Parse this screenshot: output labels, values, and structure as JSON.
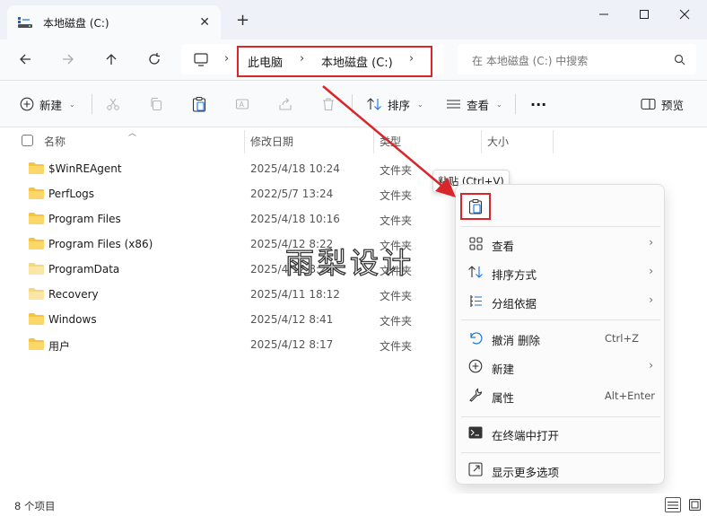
{
  "window": {
    "tab_title": "本地磁盘 (C:)",
    "new_tab_label": "+",
    "close_tab_label": "✕"
  },
  "nav": {
    "breadcrumbs": [
      "此电脑",
      "本地磁盘 (C:)"
    ],
    "search_placeholder": "在 本地磁盘 (C:) 中搜索"
  },
  "toolbar": {
    "new_label": "新建",
    "sort_label": "排序",
    "view_label": "查看",
    "more_label": "...",
    "preview_label": "预览"
  },
  "columns": {
    "name": "名称",
    "date": "修改日期",
    "type": "类型",
    "size": "大小"
  },
  "files": [
    {
      "name": "$WinREAgent",
      "date": "2025/4/18 10:24",
      "type": "文件夹"
    },
    {
      "name": "PerfLogs",
      "date": "2022/5/7 13:24",
      "type": "文件夹"
    },
    {
      "name": "Program Files",
      "date": "2025/4/18 10:16",
      "type": "文件夹"
    },
    {
      "name": "Program Files (x86)",
      "date": "2025/4/12 8:22",
      "type": "文件夹"
    },
    {
      "name": "ProgramData",
      "date": "2025/4/12 8:22",
      "type": "文件夹"
    },
    {
      "name": "Recovery",
      "date": "2025/4/11 18:12",
      "type": "文件夹"
    },
    {
      "name": "Windows",
      "date": "2025/4/12 8:41",
      "type": "文件夹"
    },
    {
      "name": "用户",
      "date": "2025/4/12 8:17",
      "type": "文件夹"
    }
  ],
  "status": {
    "item_count": "8 个项目"
  },
  "tooltip": {
    "text": "粘贴 (Ctrl+V)"
  },
  "context_menu": {
    "items": [
      {
        "label": "查看",
        "shortcut": "",
        "submenu": true
      },
      {
        "label": "排序方式",
        "shortcut": "",
        "submenu": true
      },
      {
        "label": "分组依据",
        "shortcut": "",
        "submenu": true
      },
      {
        "label": "撤消 删除",
        "shortcut": "Ctrl+Z",
        "submenu": false
      },
      {
        "label": "新建",
        "shortcut": "",
        "submenu": true
      },
      {
        "label": "属性",
        "shortcut": "Alt+Enter",
        "submenu": false
      },
      {
        "label": "在终端中打开",
        "shortcut": "",
        "submenu": false
      },
      {
        "label": "显示更多选项",
        "shortcut": "",
        "submenu": false
      }
    ]
  },
  "watermark": {
    "text": "雨梨设计"
  },
  "colors": {
    "highlight_red": "#d9262b",
    "folder_yellow": "#f5c542",
    "accent_blue": "#1a73d9"
  }
}
